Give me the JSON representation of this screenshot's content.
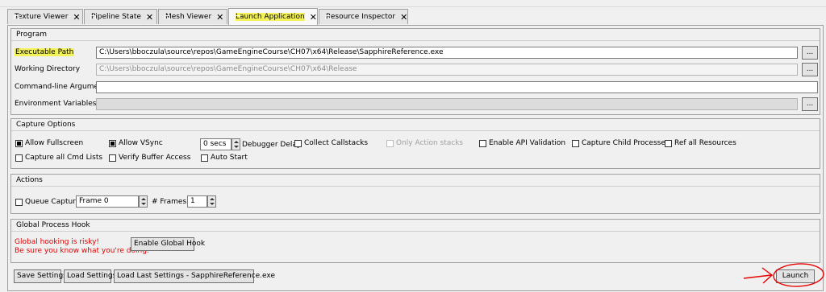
{
  "tabs": [
    {
      "label": "Texture Viewer",
      "close": "✕"
    },
    {
      "label": "Pipeline State",
      "close": "✕"
    },
    {
      "label": "Mesh Viewer",
      "close": "✕"
    },
    {
      "label": "Launch Application",
      "close": "✕"
    },
    {
      "label": "Resource Inspector",
      "close": "✕"
    }
  ],
  "program": {
    "title": "Program",
    "executable_path_label": "Executable Path",
    "executable_path_value": "C:\\Users\\bboczula\\source\\repos\\GameEngineCourse\\CH07\\x64\\Release\\SapphireReference.exe",
    "working_directory_label": "Working Directory",
    "working_directory_value": "C:\\Users\\bboczula\\source\\repos\\GameEngineCourse\\CH07\\x64\\Release",
    "cmdline_label": "Command-line Arguments",
    "cmdline_value": "",
    "env_label": "Environment Variables",
    "env_value": "",
    "browse_label": "..."
  },
  "capture": {
    "title": "Capture Options",
    "allow_fullscreen": "Allow Fullscreen",
    "allow_vsync": "Allow VSync",
    "delay_value": "0 secs",
    "debugger_delay": "Debugger Delay",
    "collect_callstacks": "Collect Callstacks",
    "only_action_stacks": "Only Action stacks",
    "enable_api_validation": "Enable API Validation",
    "capture_child_processes": "Capture Child Processes",
    "ref_all_resources": "Ref all Resources",
    "capture_all_cmd_lists": "Capture all Cmd Lists",
    "verify_buffer_access": "Verify Buffer Access",
    "auto_start": "Auto Start"
  },
  "actions": {
    "title": "Actions",
    "queue_capture": "Queue Capture",
    "frame_value": "Frame 0",
    "num_frames_label": "# Frames:",
    "num_frames_value": "1"
  },
  "hook": {
    "title": "Global Process Hook",
    "warning_line1": "Global hooking is risky!",
    "warning_line2": "Be sure you know what you're doing.",
    "enable_button": "Enable Global Hook"
  },
  "footer": {
    "save_settings": "Save Settings",
    "load_settings": "Load Settings",
    "load_last": "Load Last Settings - SapphireReference.exe",
    "launch": "Launch"
  },
  "colors": {
    "highlight": "#f3f25a",
    "annotation": "#e60000",
    "warning_text": "#e00000",
    "tab_icon": "#4aa84a"
  }
}
